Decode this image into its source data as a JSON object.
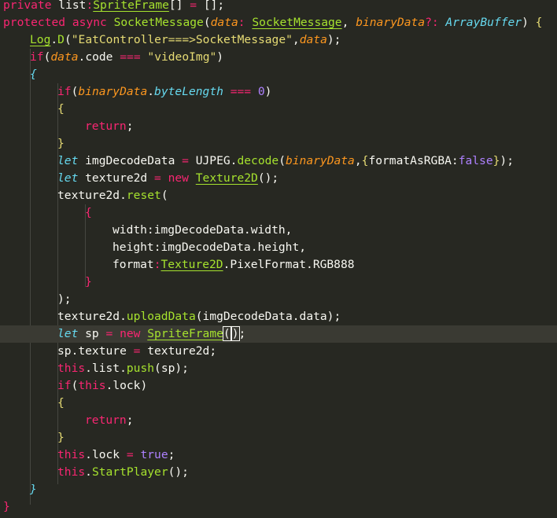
{
  "editor": {
    "theme_colors": {
      "background": "#272822",
      "foreground": "#F8F8F2",
      "keyword": "#F92672",
      "storage": "#66D9EF",
      "class": "#A6E22E",
      "parameter": "#FD971F",
      "string": "#E6DB74",
      "number": "#AE81FF",
      "current_line": "#3A3A33"
    },
    "lines": [
      {
        "tokens": [
          {
            "t": "private",
            "c": "kw"
          },
          {
            "t": " list",
            "c": ""
          },
          {
            "t": ":",
            "c": "kw"
          },
          {
            "t": "SpriteFrame",
            "c": "cl"
          },
          {
            "t": "[] ",
            "c": ""
          },
          {
            "t": "=",
            "c": "kw"
          },
          {
            "t": " [];",
            "c": ""
          }
        ]
      },
      {
        "tokens": [
          {
            "t": "protected",
            "c": "kw"
          },
          {
            "t": " ",
            "c": ""
          },
          {
            "t": "async",
            "c": "kw"
          },
          {
            "t": " ",
            "c": ""
          },
          {
            "t": "SocketMessage",
            "c": "fn"
          },
          {
            "t": "(",
            "c": ""
          },
          {
            "t": "data",
            "c": "prm"
          },
          {
            "t": ": ",
            "c": "kw"
          },
          {
            "t": "SocketMessage",
            "c": "cl"
          },
          {
            "t": ", ",
            "c": ""
          },
          {
            "t": "binaryData",
            "c": "prm"
          },
          {
            "t": "?: ",
            "c": "kw"
          },
          {
            "t": "ArrayBuffer",
            "c": "sk"
          },
          {
            "t": ") ",
            "c": ""
          },
          {
            "t": "{",
            "c": "brm"
          }
        ]
      },
      {
        "tokens": [
          {
            "t": "Log",
            "c": "cl"
          },
          {
            "t": ".",
            "c": ""
          },
          {
            "t": "D",
            "c": "fn"
          },
          {
            "t": "(",
            "c": ""
          },
          {
            "t": "\"EatController===>SocketMessage\"",
            "c": "str"
          },
          {
            "t": ",",
            "c": ""
          },
          {
            "t": "data",
            "c": "prm"
          },
          {
            "t": ");",
            "c": ""
          }
        ]
      },
      {
        "tokens": [
          {
            "t": "if",
            "c": "kw"
          },
          {
            "t": "(",
            "c": ""
          },
          {
            "t": "data",
            "c": "prm"
          },
          {
            "t": ".code ",
            "c": ""
          },
          {
            "t": "===",
            "c": "kw"
          },
          {
            "t": " ",
            "c": ""
          },
          {
            "t": "\"videoImg\"",
            "c": "str"
          },
          {
            "t": ")",
            "c": ""
          }
        ]
      },
      {
        "tokens": [
          {
            "t": "{",
            "c": "sk"
          }
        ]
      },
      {
        "tokens": [
          {
            "t": "if",
            "c": "kw"
          },
          {
            "t": "(",
            "c": ""
          },
          {
            "t": "binaryData",
            "c": "prm"
          },
          {
            "t": ".",
            "c": ""
          },
          {
            "t": "byteLength",
            "c": "sk"
          },
          {
            "t": " ",
            "c": ""
          },
          {
            "t": "===",
            "c": "kw"
          },
          {
            "t": " ",
            "c": ""
          },
          {
            "t": "0",
            "c": "num"
          },
          {
            "t": ")",
            "c": ""
          }
        ]
      },
      {
        "tokens": [
          {
            "t": "{",
            "c": "brm"
          }
        ]
      },
      {
        "tokens": [
          {
            "t": "return",
            "c": "kw"
          },
          {
            "t": ";",
            "c": ""
          }
        ]
      },
      {
        "tokens": [
          {
            "t": "}",
            "c": "brm"
          }
        ]
      },
      {
        "tokens": [
          {
            "t": "let",
            "c": "sk"
          },
          {
            "t": " imgDecodeData ",
            "c": ""
          },
          {
            "t": "=",
            "c": "kw"
          },
          {
            "t": " UJPEG.",
            "c": ""
          },
          {
            "t": "decode",
            "c": "fn"
          },
          {
            "t": "(",
            "c": ""
          },
          {
            "t": "binaryData",
            "c": "prm"
          },
          {
            "t": ",",
            "c": ""
          },
          {
            "t": "{",
            "c": "brm"
          },
          {
            "t": "formatAsRGBA:",
            "c": ""
          },
          {
            "t": "false",
            "c": "cst"
          },
          {
            "t": "}",
            "c": "brm"
          },
          {
            "t": ");",
            "c": ""
          }
        ]
      },
      {
        "tokens": [
          {
            "t": "let",
            "c": "sk"
          },
          {
            "t": " texture2d ",
            "c": ""
          },
          {
            "t": "=",
            "c": "kw"
          },
          {
            "t": " ",
            "c": ""
          },
          {
            "t": "new",
            "c": "kw"
          },
          {
            "t": " ",
            "c": ""
          },
          {
            "t": "Texture2D",
            "c": "cl"
          },
          {
            "t": "();",
            "c": ""
          }
        ]
      },
      {
        "tokens": [
          {
            "t": "texture2d.",
            "c": ""
          },
          {
            "t": "reset",
            "c": "fn"
          },
          {
            "t": "(",
            "c": ""
          }
        ]
      },
      {
        "tokens": [
          {
            "t": "{",
            "c": "kw"
          }
        ]
      },
      {
        "tokens": [
          {
            "t": "width:imgDecodeData.width,",
            "c": ""
          }
        ]
      },
      {
        "tokens": [
          {
            "t": "height:imgDecodeData.height,",
            "c": ""
          }
        ]
      },
      {
        "tokens": [
          {
            "t": "format",
            "c": ""
          },
          {
            "t": ":",
            "c": "kw"
          },
          {
            "t": "Texture2D",
            "c": "cl"
          },
          {
            "t": ".PixelFormat.RGB888",
            "c": ""
          }
        ]
      },
      {
        "tokens": [
          {
            "t": "}",
            "c": "kw"
          }
        ]
      },
      {
        "tokens": [
          {
            "t": ");",
            "c": ""
          }
        ]
      },
      {
        "tokens": [
          {
            "t": "texture2d.",
            "c": ""
          },
          {
            "t": "uploadData",
            "c": "fn"
          },
          {
            "t": "(imgDecodeData.data);",
            "c": ""
          }
        ]
      },
      {
        "tokens": [
          {
            "t": "let",
            "c": "sk"
          },
          {
            "t": " sp ",
            "c": ""
          },
          {
            "t": "=",
            "c": "kw"
          },
          {
            "t": " ",
            "c": ""
          },
          {
            "t": "new",
            "c": "kw"
          },
          {
            "t": " ",
            "c": ""
          },
          {
            "t": "SpriteFrame",
            "c": "cl"
          },
          {
            "t": "(",
            "c": "brc"
          },
          {
            "t": "",
            "c": "cursor"
          },
          {
            "t": ")",
            "c": "brc"
          },
          {
            "t": ";",
            "c": ""
          }
        ]
      },
      {
        "tokens": [
          {
            "t": "sp.texture ",
            "c": ""
          },
          {
            "t": "=",
            "c": "kw"
          },
          {
            "t": " texture2d;",
            "c": ""
          }
        ]
      },
      {
        "tokens": [
          {
            "t": "this",
            "c": "kw"
          },
          {
            "t": ".list.",
            "c": ""
          },
          {
            "t": "push",
            "c": "fn"
          },
          {
            "t": "(sp);",
            "c": ""
          }
        ]
      },
      {
        "tokens": [
          {
            "t": "if",
            "c": "kw"
          },
          {
            "t": "(",
            "c": ""
          },
          {
            "t": "this",
            "c": "kw"
          },
          {
            "t": ".lock)",
            "c": ""
          }
        ]
      },
      {
        "tokens": [
          {
            "t": "{",
            "c": "brm"
          }
        ]
      },
      {
        "tokens": [
          {
            "t": "return",
            "c": "kw"
          },
          {
            "t": ";",
            "c": ""
          }
        ]
      },
      {
        "tokens": [
          {
            "t": "}",
            "c": "brm"
          }
        ]
      },
      {
        "tokens": [
          {
            "t": "this",
            "c": "kw"
          },
          {
            "t": ".lock ",
            "c": ""
          },
          {
            "t": "=",
            "c": "kw"
          },
          {
            "t": " ",
            "c": ""
          },
          {
            "t": "true",
            "c": "cst"
          },
          {
            "t": ";",
            "c": ""
          }
        ]
      },
      {
        "tokens": [
          {
            "t": "this",
            "c": "kw"
          },
          {
            "t": ".",
            "c": ""
          },
          {
            "t": "StartPlayer",
            "c": "fn"
          },
          {
            "t": "();",
            "c": ""
          }
        ]
      },
      {
        "tokens": [
          {
            "t": "}",
            "c": "sk"
          }
        ]
      },
      {
        "tokens": [
          {
            "t": "}",
            "c": "kw"
          }
        ]
      }
    ]
  }
}
